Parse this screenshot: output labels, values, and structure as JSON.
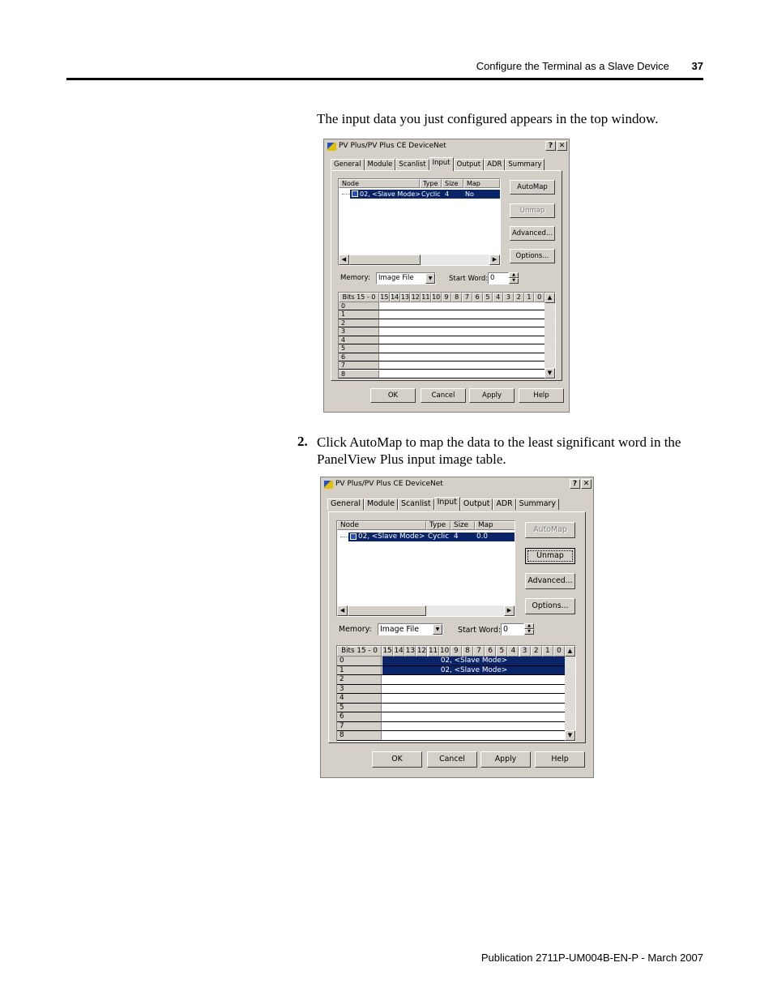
{
  "header": {
    "section": "Configure the Terminal as a Slave Device",
    "page_number": "37"
  },
  "intro_text": "The input data you just configured appears in the top window.",
  "step2": {
    "number": "2.",
    "text": "Click AutoMap to map the data to the least significant word in the PanelView Plus input image table."
  },
  "footer": {
    "publication": "Publication 2711P-UM004B-EN-P - March 2007"
  },
  "dialog1": {
    "title": "PV Plus/PV Plus CE DeviceNet",
    "help_glyph": "?",
    "close_glyph": "✕",
    "tabs": [
      "General",
      "Module",
      "Scanlist",
      "Input",
      "Output",
      "ADR",
      "Summary"
    ],
    "columns": [
      "Node",
      "Type",
      "Size",
      "Map"
    ],
    "row": {
      "node": "02, <Slave Mode>",
      "type": "Cyclic",
      "size": "4",
      "map": "No"
    },
    "buttons": {
      "automap": "AutoMap",
      "unmap": "Unmap",
      "advanced": "Advanced...",
      "options": "Options..."
    },
    "memory_label": "Memory:",
    "memory_value": "Image File",
    "start_word_label": "Start Word:",
    "start_word_value": "0",
    "bits_header": "Bits 15 - 0",
    "bits": [
      "15",
      "14",
      "13",
      "12",
      "11",
      "10",
      "9",
      "8",
      "7",
      "6",
      "5",
      "4",
      "3",
      "2",
      "1",
      "0"
    ],
    "word_rows": [
      "0",
      "1",
      "2",
      "3",
      "4",
      "5",
      "6",
      "7",
      "8"
    ],
    "mapped": [],
    "footer_buttons": {
      "ok": "OK",
      "cancel": "Cancel",
      "apply": "Apply",
      "help": "Help"
    }
  },
  "dialog2": {
    "title": "PV Plus/PV Plus CE DeviceNet",
    "help_glyph": "?",
    "close_glyph": "✕",
    "tabs": [
      "General",
      "Module",
      "Scanlist",
      "Input",
      "Output",
      "ADR",
      "Summary"
    ],
    "columns": [
      "Node",
      "Type",
      "Size",
      "Map"
    ],
    "row": {
      "node": "02, <Slave Mode>",
      "type": "Cyclic",
      "size": "4",
      "map": "0.0"
    },
    "buttons": {
      "automap": "AutoMap",
      "unmap": "Unmap",
      "advanced": "Advanced...",
      "options": "Options..."
    },
    "memory_label": "Memory:",
    "memory_value": "Image File",
    "start_word_label": "Start Word:",
    "start_word_value": "0",
    "bits_header": "Bits 15 - 0",
    "bits": [
      "15",
      "14",
      "13",
      "12",
      "11",
      "10",
      "9",
      "8",
      "7",
      "6",
      "5",
      "4",
      "3",
      "2",
      "1",
      "0"
    ],
    "word_rows": [
      "0",
      "1",
      "2",
      "3",
      "4",
      "5",
      "6",
      "7",
      "8"
    ],
    "mapped": [
      "02, <Slave Mode>",
      "02, <Slave Mode>"
    ],
    "footer_buttons": {
      "ok": "OK",
      "cancel": "Cancel",
      "apply": "Apply",
      "help": "Help"
    }
  },
  "colors": {
    "selection": "#0a246a",
    "dialog_face": "#d4d0c8"
  }
}
